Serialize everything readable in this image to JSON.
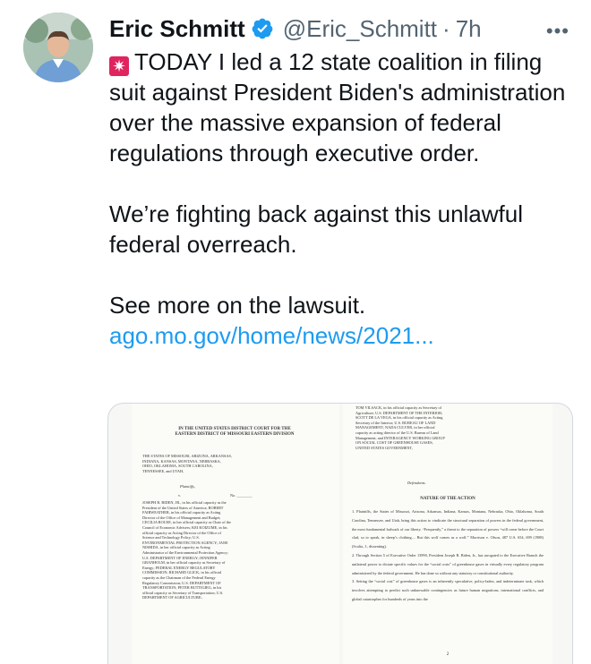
{
  "author": {
    "name": "Eric Schmitt",
    "handle": "@Eric_Schmitt",
    "separator": "·",
    "time": "7h"
  },
  "more_label": "•••",
  "tweet": {
    "emoji_glyph": "✷",
    "emoji_name": "police-light-icon",
    "para1": "TODAY I led a 12 state coalition in filing suit against President Biden's administration over the massive expansion of federal regulations through executive order.",
    "para2": "We’re fighting back against this unlawful federal overreach.",
    "para3": "See more on the lawsuit.",
    "link": "ago.mo.gov/home/news/2021..."
  },
  "document": {
    "court_title": "IN THE UNITED STATES DISTRICT COURT FOR THE EASTERN DISTRICT OF MISSOURI EASTERN DIVISION",
    "plaintiffs_text": "THE STATES OF MISSOURI, ARIZONA, ARKANSAS, INDIANA, KANSAS, MONTANA, NEBRASKA, OHIO, OKLAHOMA, SOUTH CAROLINA, TENNESSEE, and UTAH,",
    "plaintiffs_label": "Plaintiffs,",
    "v_label": "v.",
    "no_label": "No. ________",
    "defendants_left": "JOSEPH R. BIDEN, JR., in his official capacity as the President of the United States of America; ROBERT FAIRWEATHER, in his official capacity as Acting Director of the Office of Management and Budget; CECILIA ROUSE, in her official capacity as Chair of the Council of Economic Advisers; KEI KOIZUME, in his official capacity as Acting Director of the Office of Science and Technology Policy; U.S. ENVIRONMENTAL PROTECTION AGENCY; JANE NISHIDA, in her official capacity as Acting Administrator of the Environmental Protection Agency; U.S. DEPARTMENT OF ENERGY; JENNIFER GRANHOLM, in her official capacity as Secretary of Energy; FEDERAL ENERGY REGULATORY COMMISSION; RICHARD GLICK, in his official capacity as the Chairman of the Federal Energy Regulatory Commission; U.S. DEPARTMENT OF TRANSPORTATION; PETER BUTTIGIEG, in his official capacity as Secretary of Transportation; U.S. DEPARTMENT OF AGRICULTURE;",
    "defendants_right": "TOM VILSACK, in his official capacity as Secretary of Agriculture; U.S. DEPARTMENT OF THE INTERIOR; SCOTT DE LA VEGA, in his official capacity as Acting Secretary of the Interior; U.S. BUREAU OF LAND MANAGEMENT; NADA CULVER, in her official capacity as acting director of the U.S. Bureau of Land Management; and INTERAGENCY WORKING GROUP ON SOCIAL COST OF GREENHOUSE GASES, UNITED STATES GOVERNMENT,",
    "defendants_label": "Defendants.",
    "nature_title": "NATURE OF THE ACTION",
    "nature_p1": "1. Plaintiffs, the States of Missouri, Arizona, Arkansas, Indiana, Kansas, Montana, Nebraska, Ohio, Oklahoma, South Carolina, Tennessee, and Utah, bring this action to vindicate the structural separation of powers in the federal government, the most fundamental bulwark of our liberty. “Frequently,” a threat to the separation of powers “will come before the Court clad, so to speak, in sheep’s clothing.... But this wolf comes as a wolf.” Morrison v. Olson, 487 U.S. 654, 699 (1988) (Scalia, J., dissenting).",
    "nature_p2": "2. Through Section 5 of Executive Order 13990, President Joseph R. Biden, Jr., has arrogated to the Executive Branch the unilateral power to dictate specific values for the “social costs” of greenhouse gases in virtually every regulatory program administered by the federal government. He has done so without any statutory or constitutional authority.",
    "nature_p3": "3. Setting the “social cost” of greenhouse gases is an inherently speculative, policy-laden, and indeterminate task, which involves attempting to predict such unknowable contingencies as future human migrations, international conflicts, and global catastrophes for hundreds of years into the",
    "page_number": "2"
  },
  "colors": {
    "link": "#1d9bf0",
    "verified": "#1d9bf0",
    "secondary_text": "#536471",
    "emoji_bg": "#e0245e"
  }
}
